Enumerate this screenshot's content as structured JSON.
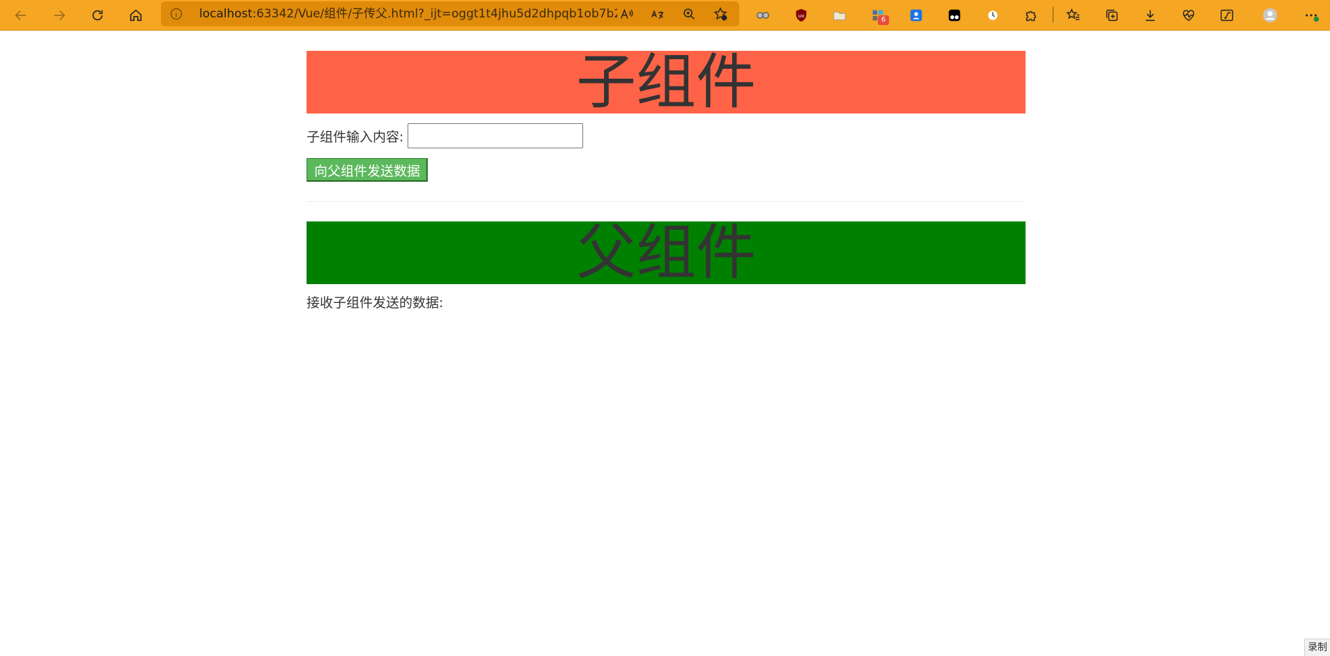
{
  "browser": {
    "url_host": "localhost",
    "url_rest": ":63342/Vue/组件/子传父.html?_ijt=oggt1t4jhu5d2dhpqb1ob7b2...",
    "extension_badge": "6",
    "toolbar_color": "#f5a623"
  },
  "child": {
    "title": "子组件",
    "input_label": "子组件输入内容:",
    "input_value": "",
    "send_button": "向父组件发送数据",
    "banner_color": "#ff6347"
  },
  "parent": {
    "title": "父组件",
    "received_label": "接收子组件发送的数据:",
    "received_value": "",
    "banner_color": "#008000"
  },
  "corner": {
    "record_label": "录制"
  }
}
